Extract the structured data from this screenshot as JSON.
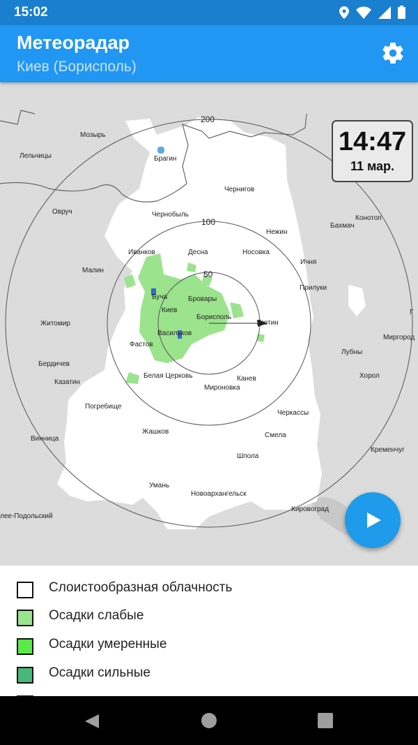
{
  "status_bar": {
    "time": "15:02",
    "icons": [
      "location-icon",
      "wifi-icon",
      "signal-icon",
      "battery-icon"
    ]
  },
  "app_bar": {
    "title": "Метеорадар",
    "subtitle": "Киев (Борисполь)",
    "settings_icon": "gear-icon"
  },
  "map": {
    "clock": {
      "time": "14:47",
      "date": "11 мар."
    },
    "range_labels": [
      "200",
      "100",
      "50"
    ],
    "cities": [
      "Мозырь",
      "Лельчицы",
      "Брагин",
      "Овруч",
      "Чернобыль",
      "Чернигов",
      "Нежин",
      "Бахмач",
      "Конотоп",
      "Иванков",
      "Десна",
      "Носовка",
      "Ичня",
      "Малин",
      "Буча",
      "Киев",
      "Бровары",
      "Борисполь",
      "Яготин",
      "Прилуки",
      "Житомир",
      "Фастов",
      "Васильков",
      "Лубны",
      "Миргород",
      "Бердичев",
      "Белая Церковь",
      "Канев",
      "Миронoвка",
      "Хорол",
      "Казатин",
      "Погребище",
      "Черкассы",
      "Винница",
      "Жашков",
      "Смела",
      "Кременчуг",
      "Шпола",
      "Умань",
      "Новоархангельск",
      "Кировоград",
      "лее-Подольский",
      "Г"
    ]
  },
  "play_button": {
    "icon": "play-icon"
  },
  "legend": [
    {
      "label": "Слоистообразная облачность",
      "color": "#FFFFFF"
    },
    {
      "label": "Осадки слабые",
      "color": "#9BE38C"
    },
    {
      "label": "Осадки умеренные",
      "color": "#5AEB4A"
    },
    {
      "label": "Осадки сильные",
      "color": "#48B878"
    },
    {
      "label": "",
      "color": "#5FA8E6"
    }
  ],
  "nav_bar": {
    "back": "back-icon",
    "home": "home-icon",
    "recents": "recents-icon"
  }
}
